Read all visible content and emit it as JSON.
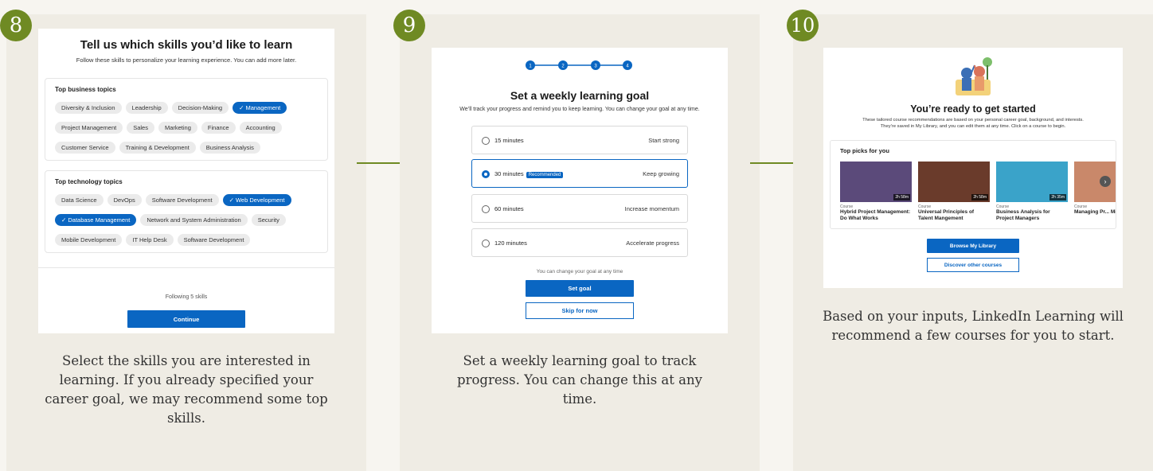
{
  "steps": [
    {
      "number": "8",
      "caption": "Select the skills you are interested in learning. If you already specified your career goal, we may recommend some top skills.",
      "screen": {
        "title": "Tell us which skills you’d like to learn",
        "subtitle": "Follow these skills to personalize your learning experience. You can add more later.",
        "business_heading": "Top business topics",
        "business_rows": [
          [
            {
              "label": "Diversity & Inclusion",
              "selected": false
            },
            {
              "label": "Leadership",
              "selected": false
            },
            {
              "label": "Decision-Making",
              "selected": false
            },
            {
              "label": "Management",
              "selected": true
            }
          ],
          [
            {
              "label": "Project Management",
              "selected": false
            },
            {
              "label": "Sales",
              "selected": false
            },
            {
              "label": "Marketing",
              "selected": false
            },
            {
              "label": "Finance",
              "selected": false
            },
            {
              "label": "Accounting",
              "selected": false
            }
          ],
          [
            {
              "label": "Customer Service",
              "selected": false
            },
            {
              "label": "Training & Development",
              "selected": false
            },
            {
              "label": "Business Analysis",
              "selected": false
            }
          ]
        ],
        "tech_heading": "Top technology topics",
        "tech_rows": [
          [
            {
              "label": "Data Science",
              "selected": false
            },
            {
              "label": "DevOps",
              "selected": false
            },
            {
              "label": "Software Development",
              "selected": false
            },
            {
              "label": "Web Development",
              "selected": true
            }
          ],
          [
            {
              "label": "Database Management",
              "selected": true
            },
            {
              "label": "Network and System Administration",
              "selected": false
            },
            {
              "label": "Security",
              "selected": false
            }
          ],
          [
            {
              "label": "Mobile Development",
              "selected": false
            },
            {
              "label": "IT Help Desk",
              "selected": false
            },
            {
              "label": "Software Development",
              "selected": false
            }
          ]
        ],
        "following": "Following 5 skills",
        "continue_label": "Continue"
      }
    },
    {
      "number": "9",
      "caption": "Set a weekly learning goal to track progress. You can change this at any time.",
      "screen": {
        "progress_steps": [
          "1",
          "2",
          "3",
          "4"
        ],
        "title": "Set a weekly learning goal",
        "subtitle": "We’ll track your progress and remind you to keep learning. You can change your goal at any time.",
        "options": [
          {
            "label": "15 minutes",
            "desc": "Start strong",
            "selected": false,
            "badge": ""
          },
          {
            "label": "30 minutes",
            "desc": "Keep growing",
            "selected": true,
            "badge": "Recommended"
          },
          {
            "label": "60 minutes",
            "desc": "Increase momentum",
            "selected": false,
            "badge": ""
          },
          {
            "label": "120 minutes",
            "desc": "Accelerate progress",
            "selected": false,
            "badge": ""
          }
        ],
        "note": "You can change your goal at any time",
        "set_goal_label": "Set goal",
        "skip_label": "Skip for now"
      }
    },
    {
      "number": "10",
      "caption": "Based on your inputs, LinkedIn Learning will recommend a few courses for you to start.",
      "screen": {
        "title": "You’re ready to get started",
        "subtitle": "These tailored course recommendations are based on your personal career goal, background, and interests. They’re saved in My Library, and you can edit them at any time. Click on a course to begin.",
        "picks_heading": "Top picks for you",
        "courses": [
          {
            "kind": "Course",
            "title": "Hybrid Project Management: Do What Works",
            "duration": "2h 58m",
            "color": "#5b4a7a"
          },
          {
            "kind": "Course",
            "title": "Universal Principles of Talent Mangement",
            "duration": "2h 58m",
            "color": "#6a3b2b"
          },
          {
            "kind": "Course",
            "title": "Business Analysis for Project Managers",
            "duration": "2h 35m",
            "color": "#3aa3c9"
          },
          {
            "kind": "Course",
            "title": "Managing Pr... Microsoft Te...",
            "duration": "",
            "color": "#c9886a"
          }
        ],
        "browse_label": "Browse My Library",
        "discover_label": "Discover other courses"
      }
    }
  ],
  "colors": {
    "brand_green": "#6f8a23",
    "linkedin_blue": "#0a66c2"
  }
}
